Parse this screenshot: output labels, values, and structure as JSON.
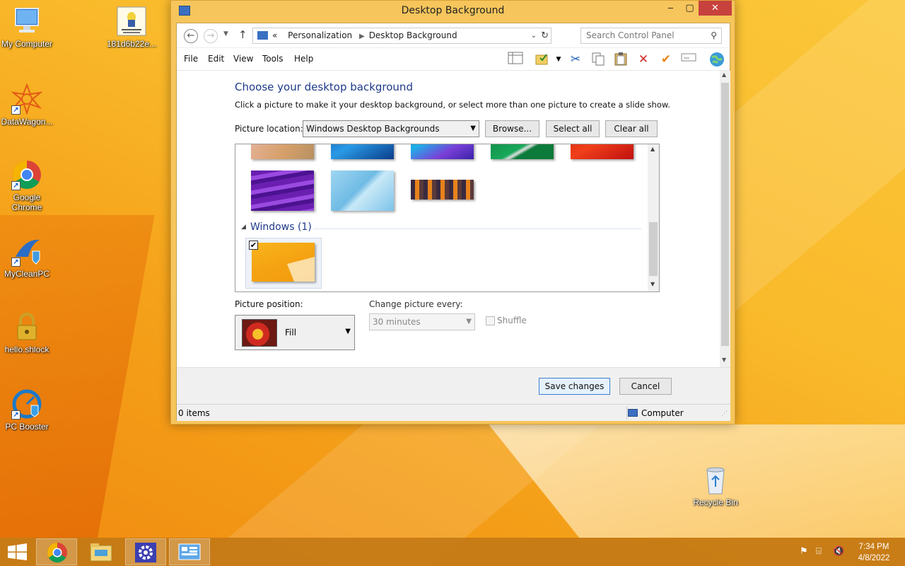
{
  "desktop": {
    "icons": [
      {
        "label": "My Computer",
        "icon": "computer-icon"
      },
      {
        "label": "181d6b22e...",
        "icon": "image-file-icon"
      },
      {
        "label": "DataWagon...",
        "icon": "datawagon-icon"
      },
      {
        "label": "Google Chrome",
        "icon": "chrome-icon"
      },
      {
        "label": "MyCleanPC",
        "icon": "mycleanpc-icon"
      },
      {
        "label": "hello.shlock",
        "icon": "lock-icon"
      },
      {
        "label": "PC Booster",
        "icon": "pc-booster-icon"
      },
      {
        "label": "Recycle Bin",
        "icon": "recycle-bin-icon"
      }
    ]
  },
  "window": {
    "title": "Desktop Background",
    "address": {
      "prefix": "«",
      "crumbs": [
        "Personalization",
        "Desktop Background"
      ],
      "search_placeholder": "Search Control Panel"
    },
    "menu": [
      "File",
      "Edit",
      "View",
      "Tools",
      "Help"
    ],
    "heading": "Choose your desktop background",
    "subtext": "Click a picture to make it your desktop background, or select more than one picture to create a slide show.",
    "picture_location_label": "Picture location:",
    "picture_location_value": "Windows Desktop Backgrounds",
    "browse_label": "Browse...",
    "select_all_label": "Select all",
    "clear_all_label": "Clear all",
    "group_title": "Windows (1)",
    "picture_position_label": "Picture position:",
    "picture_position_value": "Fill",
    "change_every_label": "Change picture every:",
    "change_every_value": "30 minutes",
    "shuffle_label": "Shuffle",
    "save_label": "Save changes",
    "cancel_label": "Cancel",
    "status_items": "0 items",
    "status_location": "Computer"
  },
  "taskbar": {
    "clock_time": "7:34 PM",
    "clock_date": "4/8/2022"
  },
  "colors": {
    "accent": "#1e3a8a",
    "titlebar": "#f6c55b",
    "close": "#c7413d",
    "taskbar": "#c47a16"
  }
}
